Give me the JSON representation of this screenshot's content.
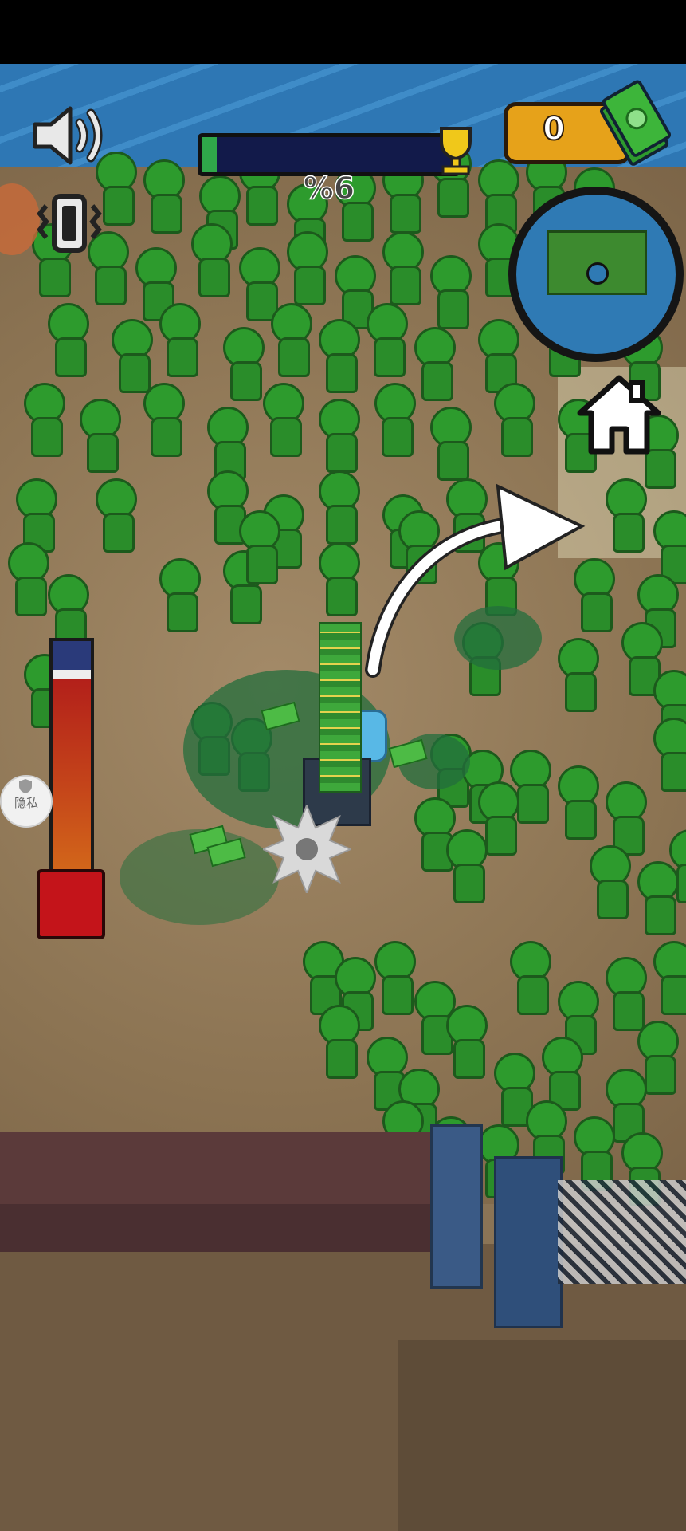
{
  "hud": {
    "progress": {
      "percent_text": "%6",
      "fill_fraction": 0.06
    },
    "money": {
      "value": "0"
    },
    "privacy_button": {
      "label": "隐私"
    }
  },
  "icons": {
    "sound": "speaker-icon",
    "vibrate": "vibration-icon",
    "trophy": "trophy-icon",
    "money": "cash-stack-icon",
    "home": "home-icon",
    "fuel": "fuel-can-icon",
    "privacy": "shield-icon"
  },
  "colors": {
    "progress_fill": "#2fa84a",
    "progress_bg": "#121a4a",
    "money_box": "#e6a21a",
    "zombie": "#2d9b2d",
    "minimap_water": "#2f7ab4",
    "fuel_can": "#c4141a"
  }
}
